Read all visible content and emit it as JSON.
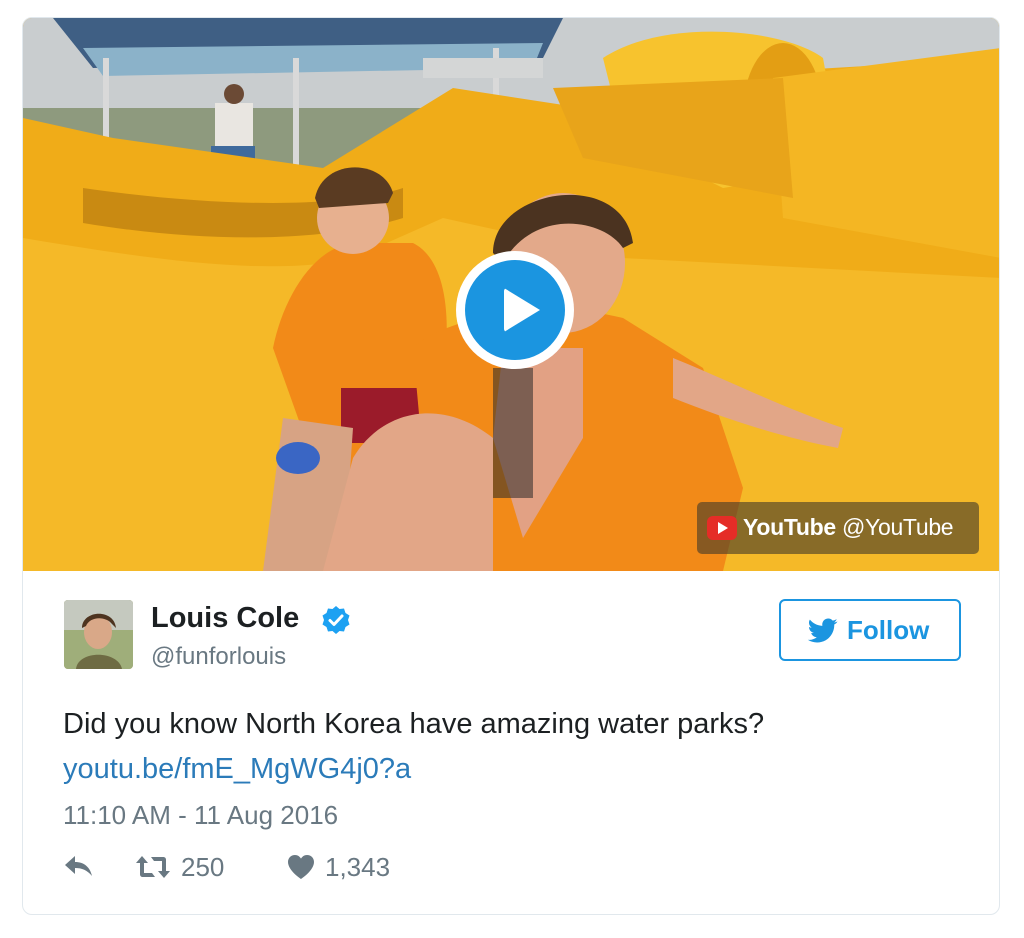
{
  "media": {
    "play_icon": "play-icon",
    "attribution": {
      "logo": "youtube-logo-icon",
      "brand": "YouTube",
      "handle": "@YouTube"
    }
  },
  "author": {
    "name": "Louis Cole",
    "verified_icon": "verified-badge-icon",
    "handle": "@funforlouis"
  },
  "follow_button": {
    "icon": "twitter-bird-icon",
    "label": "Follow"
  },
  "tweet": {
    "text": "Did you know North Korea have amazing water parks?",
    "link": "youtu.be/fmE_MgWG4j0?a",
    "timestamp": "11:10 AM - 11 Aug 2016"
  },
  "actions": {
    "reply_icon": "reply-icon",
    "retweet_icon": "retweet-icon",
    "retweets": "250",
    "like_icon": "heart-icon",
    "likes": "1,343"
  },
  "colors": {
    "accent": "#1b95e0",
    "link": "#2b7bb9",
    "youtube_red": "#e52d27",
    "slide_yellow": "#f2b21c",
    "vest_orange": "#f28a18"
  }
}
